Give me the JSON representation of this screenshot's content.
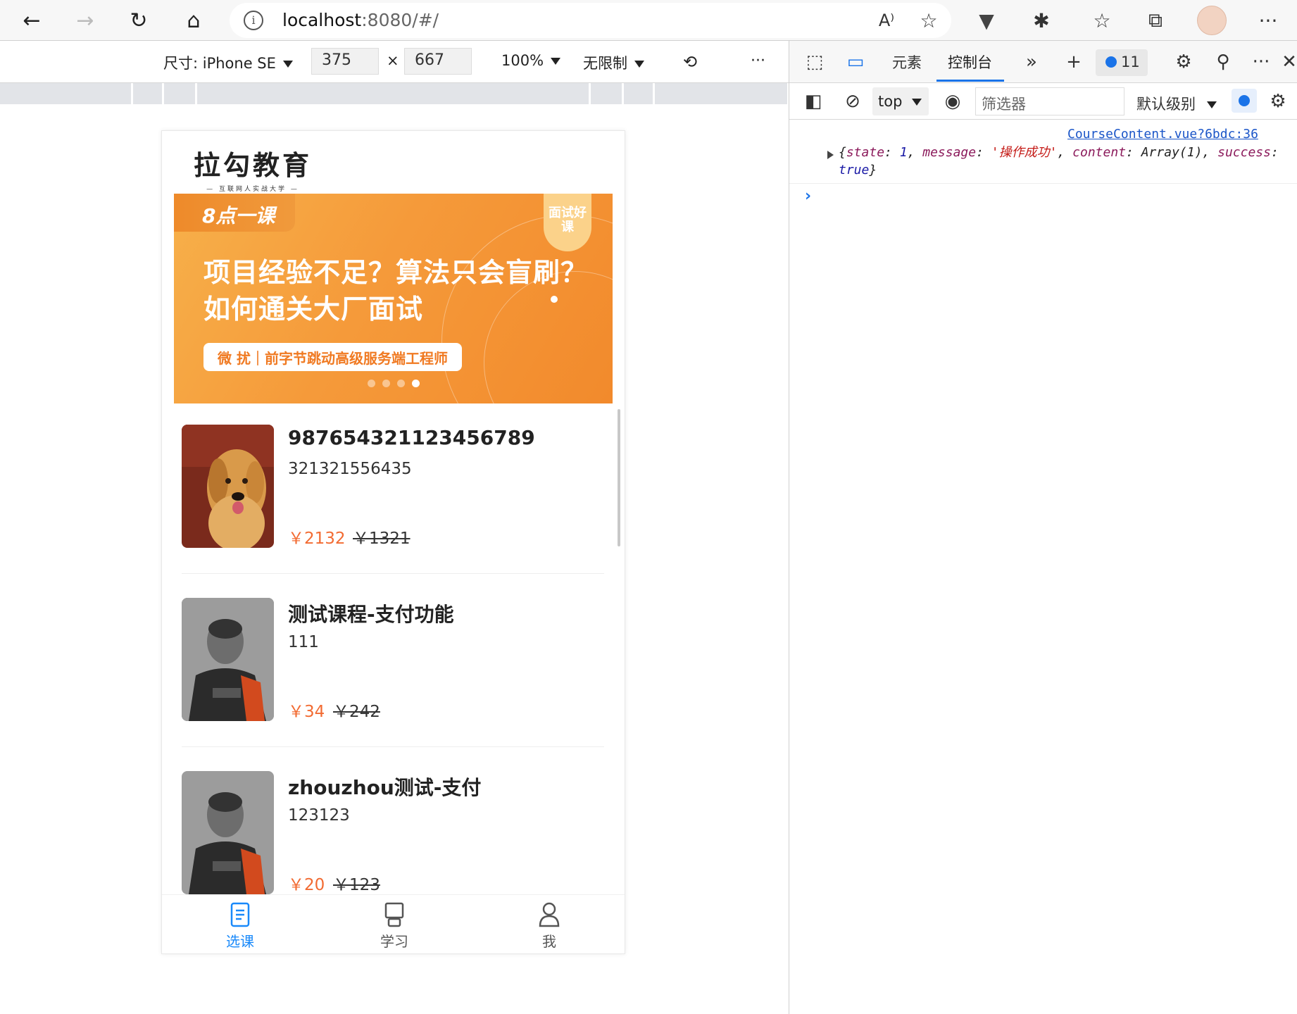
{
  "browser": {
    "url_host": "localhost",
    "url_rest": ":8080/#/"
  },
  "device_toolbar": {
    "device_label": "尺寸: iPhone SE",
    "width": "375",
    "times": "×",
    "height": "667",
    "zoom": "100%",
    "throttle": "无限制",
    "more": "⋮"
  },
  "app": {
    "logo": "拉勾教育",
    "logo_sub": "— 互联网人实战大学 —",
    "banner": {
      "tag": "8点一课",
      "ribbon": "面试好课",
      "headline_line1": "项目经验不足？算法只会盲刷？",
      "headline_line2": "如何通关大厂面试",
      "pill": "微 扰｜前字节跳动高级服务端工程师",
      "dot_count": 4,
      "active_dot": 4
    },
    "courses": [
      {
        "title": "987654321123456789",
        "desc": "321321556435",
        "price": "￥2132",
        "original_price": "￥1321",
        "thumb": "golden-retriever"
      },
      {
        "title": "测试课程-支付功能",
        "desc": "111",
        "price": "￥34",
        "original_price": "￥242",
        "thumb": "man-portrait"
      },
      {
        "title": "zhouzhou测试-支付",
        "desc": "123123",
        "price": "￥20",
        "original_price": "￥123",
        "thumb": "man-portrait"
      }
    ],
    "tabbar": [
      {
        "label": "选课",
        "icon": "document-icon",
        "active": true
      },
      {
        "label": "学习",
        "icon": "monitor-icon",
        "active": false
      },
      {
        "label": "我",
        "icon": "user-icon",
        "active": false
      }
    ],
    "active_color": "#1989fa",
    "price_color": "#f26b32"
  },
  "devtools": {
    "tab_elements": "元素",
    "tab_console": "控制台",
    "issue_count": "11",
    "context": "top",
    "filter_placeholder": "筛选器",
    "level": "默认级别",
    "log_source": "CourseContent.vue?6bdc:36",
    "log": {
      "state_key": "state",
      "state_val": "1",
      "message_key": "message",
      "message_val": "'操作成功'",
      "content_key": "content",
      "content_val": "Array(1)",
      "success_key": "success",
      "success_val": "true"
    },
    "prompt": "›"
  }
}
